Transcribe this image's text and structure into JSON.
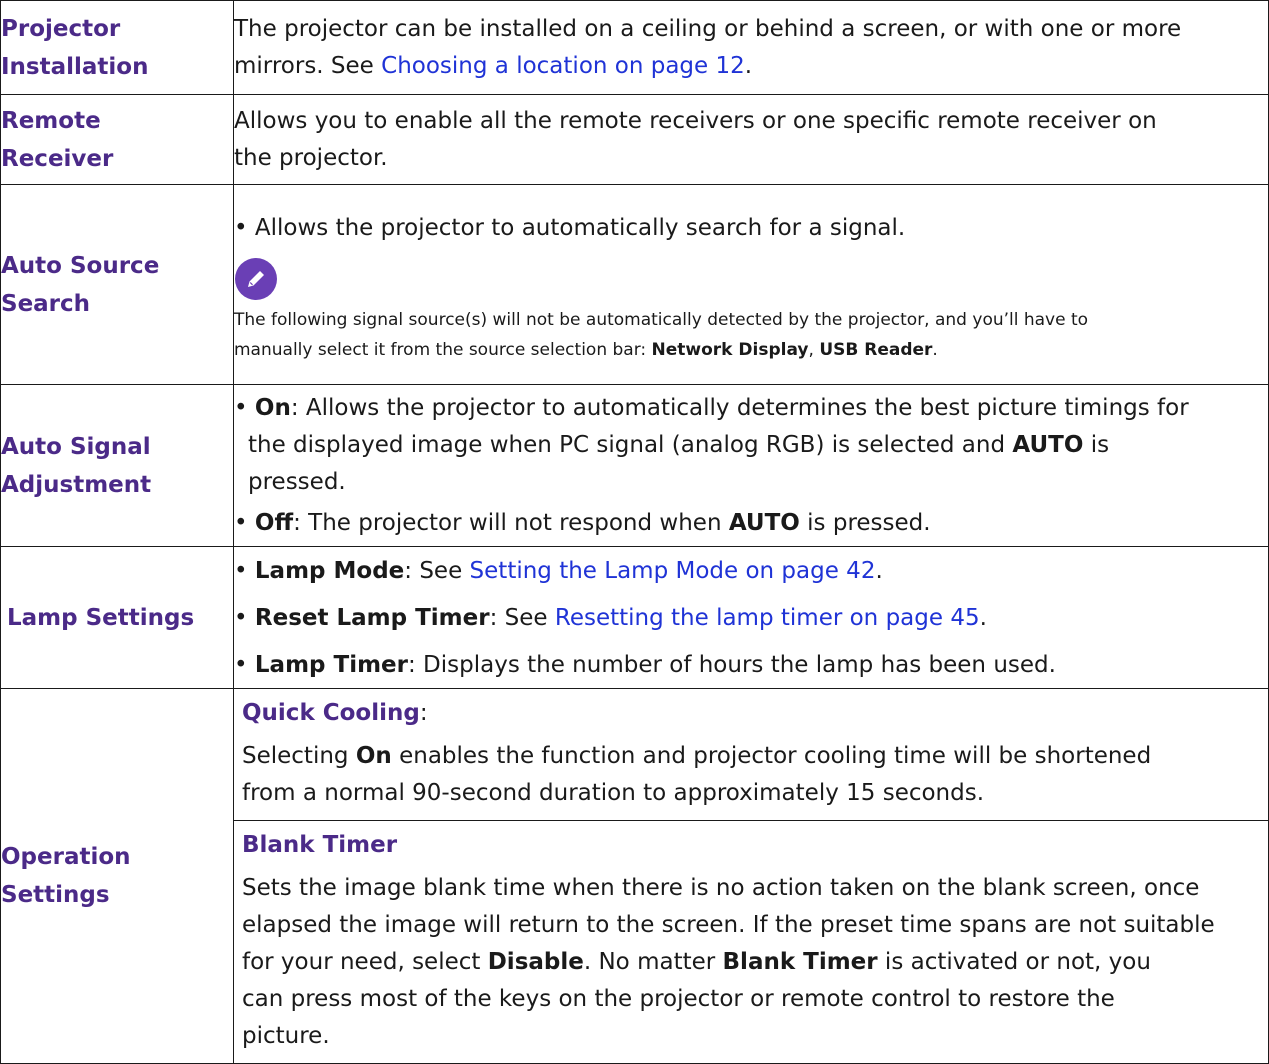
{
  "rows": {
    "projector_installation": {
      "label_line1": "Projector",
      "label_line2": "Installation",
      "desc_line1": "The projector can be installed on a ceiling or behind a screen, or with one or more",
      "desc_line2_prefix": "mirrors. See ",
      "desc_link": "Choosing a location on page 12",
      "desc_line2_suffix": "."
    },
    "remote_receiver": {
      "label_line1": "Remote",
      "label_line2": "Receiver",
      "desc_line1": "Allows you to enable all the remote receivers or one specific remote receiver on",
      "desc_line2": "the projector."
    },
    "auto_source_search": {
      "label_line1": "Auto Source",
      "label_line2": "Search",
      "bullet": "• Allows the projector to automatically search for a signal.",
      "note_icon": "pencil-note-icon",
      "note_line1": "The following signal source(s) will not be automatically detected by the projector, and you’ll have to",
      "note_line2_prefix": "manually select it from the source selection bar: ",
      "note_bold1": "Network Display",
      "note_sep": ", ",
      "note_bold2": "USB Reader",
      "note_suffix": "."
    },
    "auto_signal_adjustment": {
      "label_line1": "Auto Signal",
      "label_line2": "Adjustment",
      "on_bullet": "• ",
      "on_bold": "On",
      "on_text1": ": Allows the projector to automatically determines the best picture timings for",
      "on_text2_prefix": "the displayed image when PC signal (analog RGB) is selected and ",
      "on_text2_bold": "AUTO",
      "on_text2_suffix": " is",
      "on_text3": "pressed.",
      "off_bullet": "• ",
      "off_bold": "Off",
      "off_text_prefix": ": The projector will not respond when ",
      "off_text_bold": "AUTO",
      "off_text_suffix": " is pressed."
    },
    "lamp_settings": {
      "label": "Lamp Settings",
      "b1_prefix": "• ",
      "b1_bold": "Lamp Mode",
      "b1_mid": ": See ",
      "b1_link": "Setting the Lamp Mode on page 42",
      "b1_suffix": ".",
      "b2_prefix": "• ",
      "b2_bold": "Reset Lamp Timer",
      "b2_mid": ": See ",
      "b2_link": "Resetting the lamp timer on page 45",
      "b2_suffix": ".",
      "b3_prefix": "• ",
      "b3_bold": "Lamp Timer",
      "b3_text": ": Displays the number of hours the lamp has been used."
    },
    "operation_settings": {
      "label_line1": "Operation",
      "label_line2": "Settings",
      "quick_title": "Quick Cooling",
      "quick_title_suffix": ":",
      "quick_line1_prefix": "Selecting ",
      "quick_line1_bold": "On",
      "quick_line1_suffix": " enables the function and projector cooling time will be shortened",
      "quick_line2": "from a normal 90-second duration to approximately 15 seconds.",
      "blank_title": "Blank Timer",
      "blank_line1": "Sets the image blank time when there is no action taken on the blank screen, once",
      "blank_line2": "elapsed the image will return to the screen. If the preset time spans are not suitable",
      "blank_line3_prefix": "for your need, select ",
      "blank_line3_bold1": "Disable",
      "blank_line3_mid": ". No matter ",
      "blank_line3_bold2": "Blank Timer",
      "blank_line3_suffix": " is activated or not, you",
      "blank_line4": "can press most of the keys on the projector or remote control to restore the",
      "blank_line5": "picture."
    }
  },
  "colors": {
    "label": "#4b2a88",
    "link": "#1f33d6",
    "note_icon_bg": "#6a3fb5"
  }
}
